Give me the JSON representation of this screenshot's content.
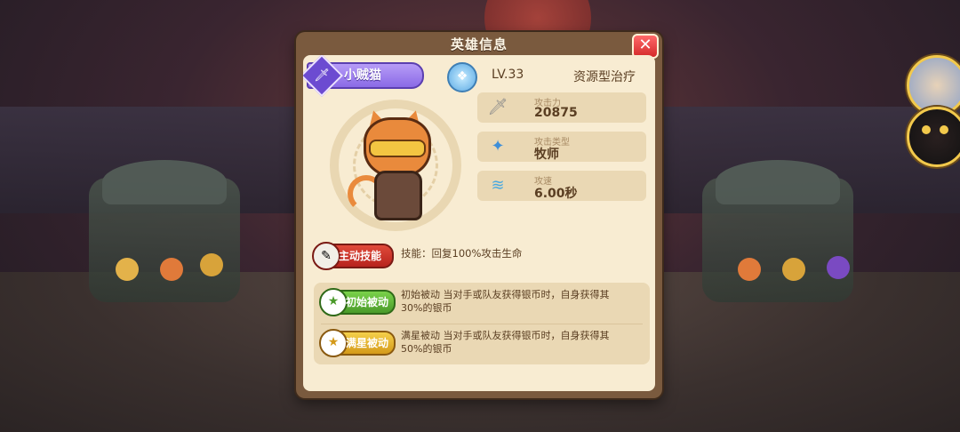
{
  "dialog": {
    "title": "英雄信息",
    "close_icon": "close-icon",
    "close_symbol": "✕"
  },
  "hero": {
    "name": "小贼猫",
    "class_icon": "dagger-icon",
    "level": "LV.33",
    "role": "资源型治疗",
    "element_icon": "water-gem-icon"
  },
  "stats": [
    {
      "label": "攻击力",
      "value": "20875",
      "icon": "sword-icon"
    },
    {
      "label": "攻击类型",
      "value": "牧师",
      "icon": "crystal-icon"
    },
    {
      "label": "攻速",
      "value": "6.00秒",
      "icon": "wind-icon"
    }
  ],
  "active_skill": {
    "badge": "主动技能",
    "description": "技能：回复100%攻击生命"
  },
  "passives": [
    {
      "badge": "初始被动",
      "line1": "初始被动  当对手或队友获得银币时，自身获得其",
      "line2": "30%的银币",
      "color": "#5fb83a"
    },
    {
      "badge": "满星被动",
      "line1": "满星被动  当对手或队友获得银币时，自身获得其",
      "line2": "50%的银币",
      "color": "#e5b32a"
    }
  ],
  "colors": {
    "panel_frame": "#7a5a3e",
    "panel_bg": "#f8ecd2",
    "stat_bg": "#ead8b4",
    "name_ribbon": "#8a6ae6",
    "active_skill": "#d4302a"
  }
}
